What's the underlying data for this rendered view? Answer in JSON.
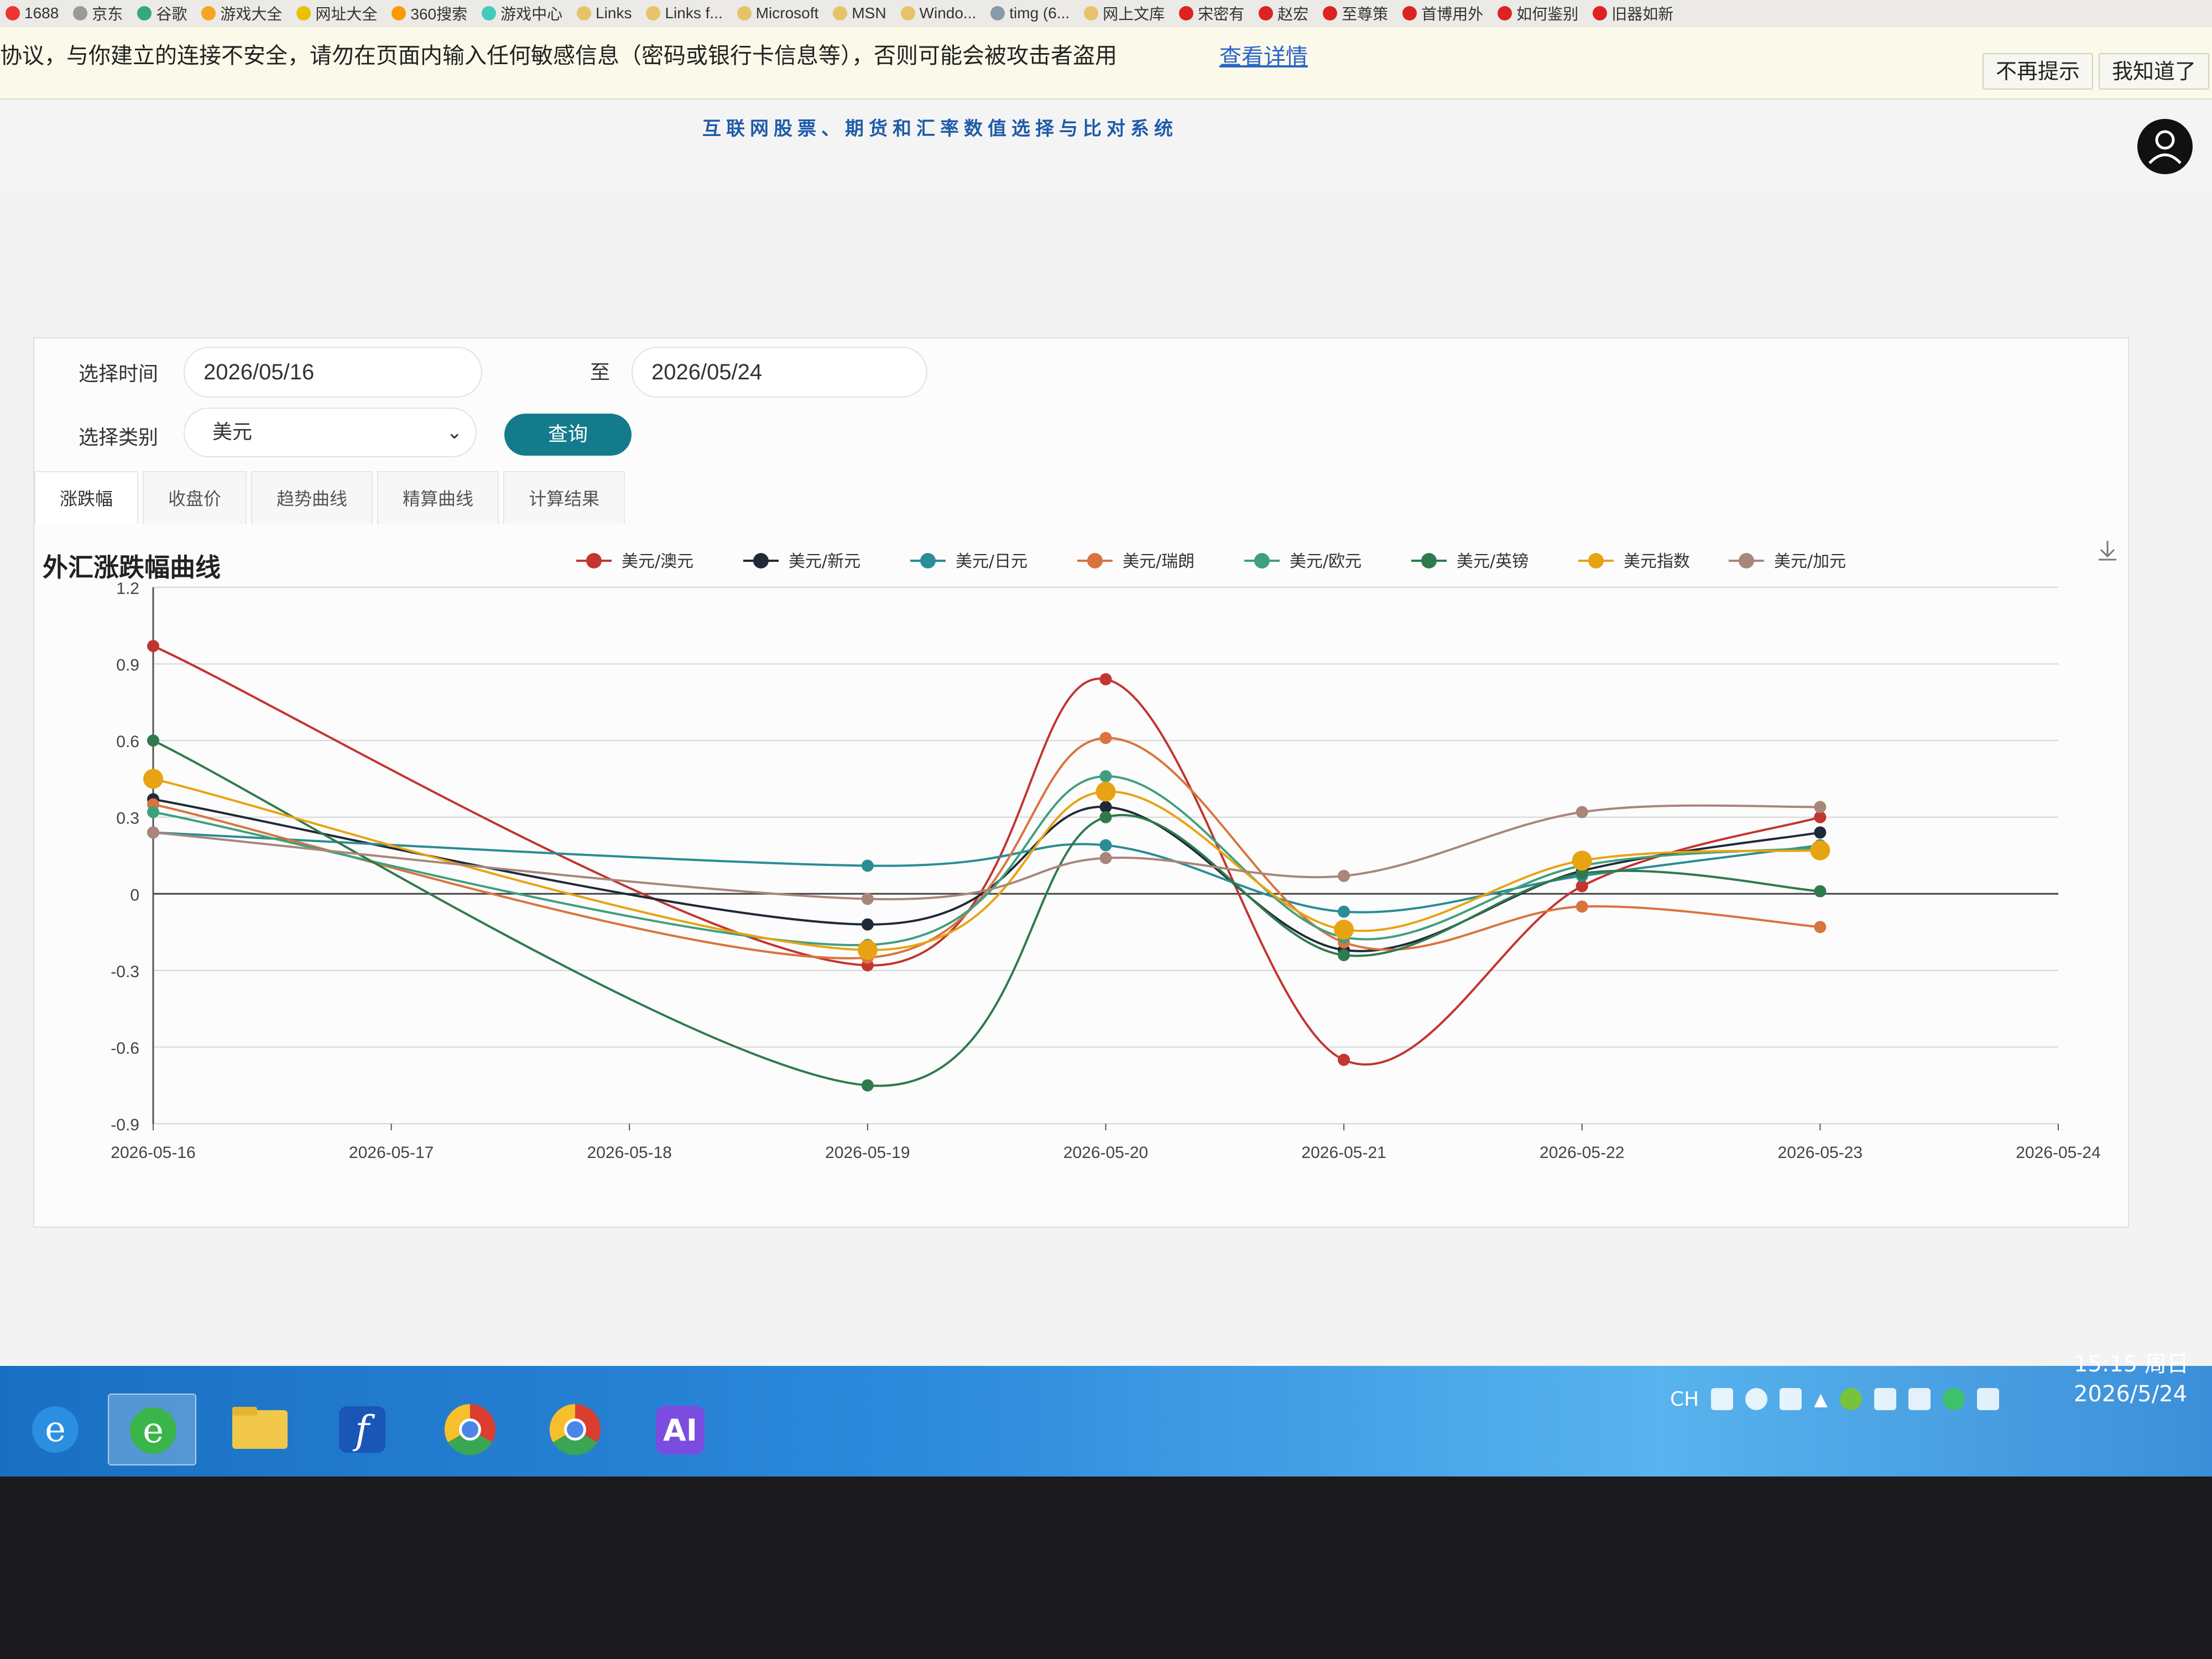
{
  "bookmarks": [
    {
      "label": "1688"
    },
    {
      "label": "京东"
    },
    {
      "label": "谷歌"
    },
    {
      "label": "游戏大全"
    },
    {
      "label": "网址大全"
    },
    {
      "label": "360搜索"
    },
    {
      "label": "游戏中心"
    },
    {
      "label": "Links"
    },
    {
      "label": "Links f..."
    },
    {
      "label": "Microsoft"
    },
    {
      "label": "MSN"
    },
    {
      "label": "Windo..."
    },
    {
      "label": "timg (6..."
    },
    {
      "label": "网上文库"
    },
    {
      "label": "宋密有"
    },
    {
      "label": "赵宏"
    },
    {
      "label": "至尊策"
    },
    {
      "label": "首博用外"
    },
    {
      "label": "如何鉴别"
    },
    {
      "label": "旧器如新"
    }
  ],
  "warning": {
    "text": "协议，与你建立的连接不安全，请勿在页面内输入任何敏感信息（密码或银行卡信息等），否则可能会被攻击者盗用",
    "link": "查看详情",
    "dismiss_label": "不再提示",
    "ok_label": "我知道了"
  },
  "header": {
    "title": "互联网股票、期货和汇率数值选择与比对系统"
  },
  "filters": {
    "time_label": "选择时间",
    "start_date": "2026/05/16",
    "to_label": "至",
    "end_date": "2026/05/24",
    "category_label": "选择类别",
    "category_value": "美元",
    "query_label": "查询"
  },
  "tabs": [
    {
      "label": "涨跌幅"
    },
    {
      "label": "收盘价"
    },
    {
      "label": "趋势曲线"
    },
    {
      "label": "精算曲线"
    },
    {
      "label": "计算结果"
    }
  ],
  "chart_title": "外汇涨跌幅曲线",
  "chart_data": {
    "type": "line",
    "title": "外汇涨跌幅曲线",
    "xlabel": "",
    "ylabel": "",
    "x": [
      "2026-05-16",
      "2026-05-17",
      "2026-05-18",
      "2026-05-19",
      "2026-05-20",
      "2026-05-21",
      "2026-05-22",
      "2026-05-23",
      "2026-05-24"
    ],
    "yticks": [
      "1.2",
      "0.9",
      "0.6",
      "0.3",
      "0",
      "-0.3",
      "-0.6",
      "-0.9"
    ],
    "ylim": [
      -0.9,
      1.2
    ],
    "grid": true,
    "legend_position": "top-center",
    "series": [
      {
        "name": "美元/澳元",
        "color": "#c23531",
        "points": [
          [
            0,
            0.97
          ],
          [
            3,
            -0.28
          ],
          [
            4,
            0.84
          ],
          [
            5,
            -0.65
          ],
          [
            6,
            0.03
          ],
          [
            7,
            0.3
          ]
        ]
      },
      {
        "name": "美元/新元",
        "color": "#1f2a36",
        "points": [
          [
            0,
            0.37
          ],
          [
            3,
            -0.12
          ],
          [
            4,
            0.34
          ],
          [
            5,
            -0.22
          ],
          [
            6,
            0.09
          ],
          [
            7,
            0.24
          ]
        ]
      },
      {
        "name": "美元/日元",
        "color": "#2a8c95",
        "points": [
          [
            0,
            0.24
          ],
          [
            3,
            0.11
          ],
          [
            4,
            0.19
          ],
          [
            5,
            -0.07
          ],
          [
            6,
            0.07
          ],
          [
            7,
            0.19
          ]
        ]
      },
      {
        "name": "美元/瑞朗",
        "color": "#d9743e",
        "points": [
          [
            0,
            0.35
          ],
          [
            3,
            -0.25
          ],
          [
            4,
            0.61
          ],
          [
            5,
            -0.19
          ],
          [
            6,
            -0.05
          ],
          [
            7,
            -0.13
          ]
        ]
      },
      {
        "name": "美元/欧元",
        "color": "#3fa07e",
        "points": [
          [
            0,
            0.32
          ],
          [
            3,
            -0.2
          ],
          [
            4,
            0.46
          ],
          [
            5,
            -0.17
          ],
          [
            6,
            0.11
          ],
          [
            7,
            0.18
          ]
        ]
      },
      {
        "name": "美元/英镑",
        "color": "#2f7a4d",
        "points": [
          [
            0,
            0.6
          ],
          [
            3,
            -0.75
          ],
          [
            4,
            0.3
          ],
          [
            5,
            -0.24
          ],
          [
            6,
            0.08
          ],
          [
            7,
            0.01
          ]
        ]
      },
      {
        "name": "美元指数",
        "color": "#e8a313",
        "points": [
          [
            0,
            0.45
          ],
          [
            3,
            -0.22
          ],
          [
            4,
            0.4
          ],
          [
            5,
            -0.14
          ],
          [
            6,
            0.13
          ],
          [
            7,
            0.17
          ]
        ]
      },
      {
        "name": "美元/加元",
        "color": "#a8867a",
        "points": [
          [
            0,
            0.24
          ],
          [
            3,
            -0.02
          ],
          [
            4,
            0.14
          ],
          [
            5,
            0.07
          ],
          [
            6,
            0.32
          ],
          [
            7,
            0.34
          ]
        ]
      }
    ]
  },
  "taskbar": {
    "tray_lang": "CH",
    "time": "15:15 周日",
    "date": "2026/5/24"
  }
}
